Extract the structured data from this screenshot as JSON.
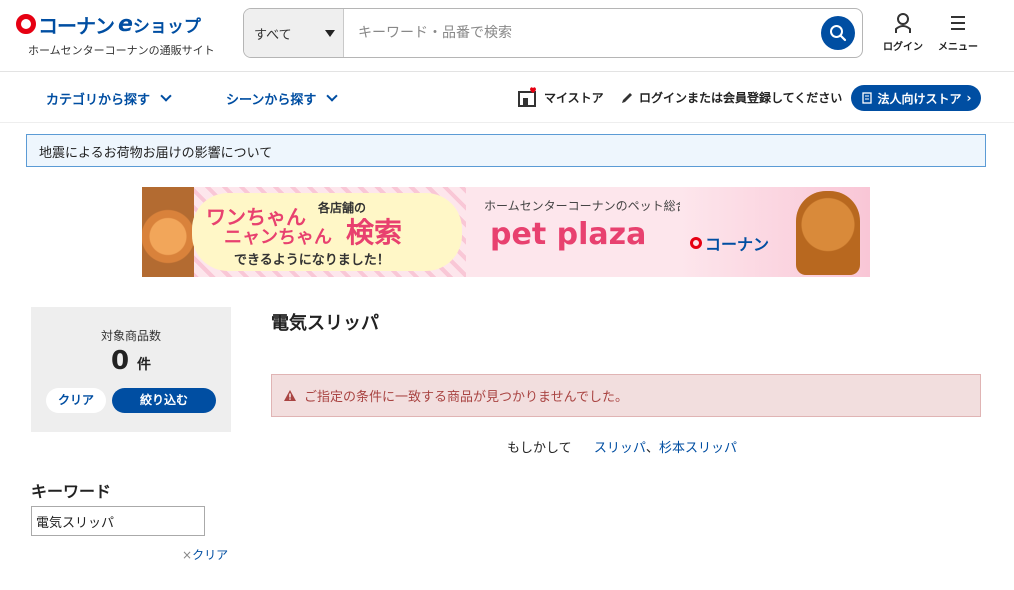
{
  "header": {
    "logo_brand": "コーナン",
    "logo_e": "e",
    "logo_shop": "ショップ",
    "logo_subtitle": "ホームセンターコーナンの通販サイト",
    "search_category": "すべて",
    "search_placeholder": "キーワード・品番で検索",
    "login_label": "ログイン",
    "menu_label": "メニュー"
  },
  "nav": {
    "category": "カテゴリから探す",
    "scene": "シーンから探す",
    "mystore": "マイストア",
    "login_register": "ログインまたは会員登録してください",
    "corporate": "法人向けストア"
  },
  "notice": "地震によるお荷物お届けの影響について",
  "banner": {
    "line1a": "ワンちゃん",
    "line1b": "各店舗の",
    "line2a": "ニャンちゃん",
    "line2b": "検索",
    "line3": "できるようになりました！",
    "site_desc": "ホームセンターコーナンのペット総合サイト",
    "pet_plaza": "pet plaza",
    "brand": "コーナン"
  },
  "filter": {
    "count_label": "対象商品数",
    "count": "0",
    "unit": "件",
    "clear": "クリア",
    "refine": "絞り込む"
  },
  "keyword": {
    "heading": "キーワード",
    "value": "電気スリッパ",
    "clear": "クリア"
  },
  "main": {
    "title": "電気スリッパ",
    "alert": "ご指定の条件に一致する商品が見つかりませんでした。",
    "suggest_label": "もしかして",
    "suggestions": [
      "スリッパ",
      "杉本スリッパ"
    ],
    "separator": "、"
  },
  "colors": {
    "brand_blue": "#004ea2",
    "brand_red": "#e60012",
    "alert_bg": "#f2dede",
    "alert_text": "#a94442"
  }
}
